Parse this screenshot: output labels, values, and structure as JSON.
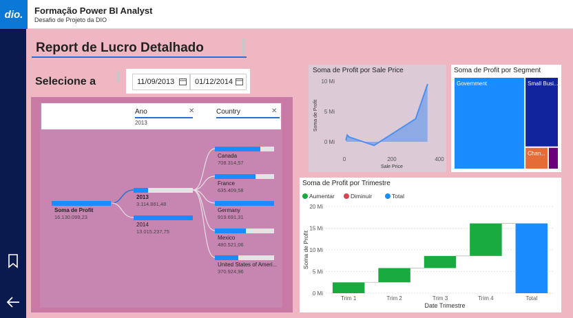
{
  "header": {
    "logo_text": "dio.",
    "title": "Formação Power BI Analyst",
    "subtitle": "Desafio de Projeto da DIO"
  },
  "rail": {
    "icons": [
      "bookmark-icon",
      "back-arrow-icon"
    ]
  },
  "report": {
    "title": "Report de Lucro Detalhado",
    "select_label": "Selecione a",
    "date_start": "11/09/2013",
    "date_end": "01/12/2014"
  },
  "decomposition": {
    "levels": [
      {
        "label": "Ano",
        "filter": "2013"
      },
      {
        "label": "Country",
        "filter": ""
      }
    ],
    "root": {
      "name": "Soma de Profit",
      "value": "16.130.099,23"
    },
    "years": [
      {
        "name": "2013",
        "value": "3.114.861,48",
        "share": 0.24,
        "selected": true
      },
      {
        "name": "2014",
        "value": "13.015.237,75",
        "share": 1.0,
        "selected": false
      }
    ],
    "countries": [
      {
        "name": "Canada",
        "value": "708.314,57",
        "share": 0.77
      },
      {
        "name": "France",
        "value": "635.409,58",
        "share": 0.69
      },
      {
        "name": "Germany",
        "value": "919.691,31",
        "share": 1.0
      },
      {
        "name": "Mexico",
        "value": "480.521,06",
        "share": 0.52
      },
      {
        "name": "United States of Ameri...",
        "value": "370.924,96",
        "share": 0.4
      }
    ]
  },
  "chart_data": [
    {
      "type": "area",
      "title": "Soma de Profit por Sale Price",
      "xlabel": "Sale Price",
      "ylabel": "Soma de Profit",
      "xlim": [
        0,
        400
      ],
      "ylim": [
        0,
        10
      ],
      "x_ticks": [
        "0",
        "200",
        "400"
      ],
      "y_ticks": [
        "0 Mi",
        "5 Mi",
        "10 Mi"
      ],
      "x": [
        7,
        10,
        12,
        15,
        20,
        125,
        300,
        350
      ],
      "y": [
        0.3,
        0.8,
        1.1,
        1.0,
        0.8,
        -0.6,
        3.8,
        9.5
      ],
      "color": "#4d8ff0"
    },
    {
      "type": "treemap",
      "title": "Soma de Profit por Segment",
      "categories": [
        "Government",
        "Small Busi...",
        "Chan...",
        ""
      ],
      "values": [
        11.4,
        4.1,
        0.9,
        0.4
      ],
      "colors": [
        "#1a8cff",
        "#12239e",
        "#e66c37",
        "#6b007b"
      ]
    },
    {
      "type": "bar",
      "subtype": "waterfall",
      "title": "Soma de Profit por Trimestre",
      "xlabel": "Date Trimestre",
      "ylabel": "Soma de Profit",
      "categories": [
        "Trim 1",
        "Trim 2",
        "Trim 3",
        "Trim 4",
        "Total"
      ],
      "starts": [
        0,
        2.5,
        5.8,
        8.6,
        0
      ],
      "ends": [
        2.5,
        5.8,
        8.6,
        16.1,
        16.1
      ],
      "ylim": [
        0,
        20
      ],
      "y_ticks": [
        "0 Mi",
        "5 Mi",
        "10 Mi",
        "15 Mi",
        "20 Mi"
      ],
      "legend": [
        {
          "name": "Aumentar",
          "color": "#1aab40"
        },
        {
          "name": "Diminuir",
          "color": "#d64550"
        },
        {
          "name": "Total",
          "color": "#1a8cff"
        }
      ]
    }
  ]
}
